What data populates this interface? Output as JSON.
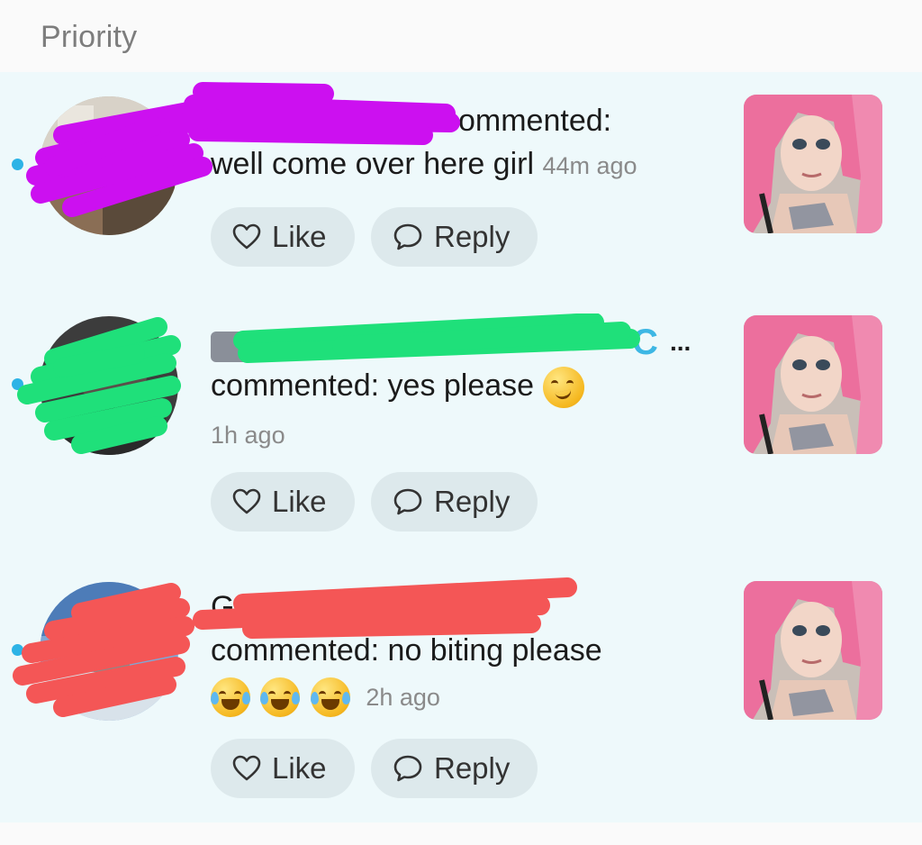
{
  "section": {
    "title": "Priority"
  },
  "notifications": [
    {
      "name_partial": "ommented:",
      "line1_prefix": "",
      "message": "well come over here girl",
      "time": "44m ago",
      "like_label": "Like",
      "reply_label": "Reply"
    },
    {
      "name_partial": "C",
      "name_ellipsis": "...",
      "message": "commented: yes please",
      "time": "1h ago",
      "like_label": "Like",
      "reply_label": "Reply"
    },
    {
      "name_partial": "G",
      "message": "commented: no biting please",
      "time": "2h ago",
      "like_label": "Like",
      "reply_label": "Reply"
    }
  ],
  "colors": {
    "feed_bg": "#eef9fb",
    "unread_dot": "#2db3e6",
    "pill_bg": "#dde9ec",
    "redaction_purple": "#cc10f0",
    "redaction_green": "#1fe07a",
    "redaction_red": "#f45656"
  },
  "icons": [
    "heart-icon",
    "chat-bubble-icon",
    "slot-machine-emoji",
    "dollar-bill-emoji",
    "inbox-tray-emoji",
    "smirk-emoji",
    "tears-of-joy-emoji"
  ]
}
